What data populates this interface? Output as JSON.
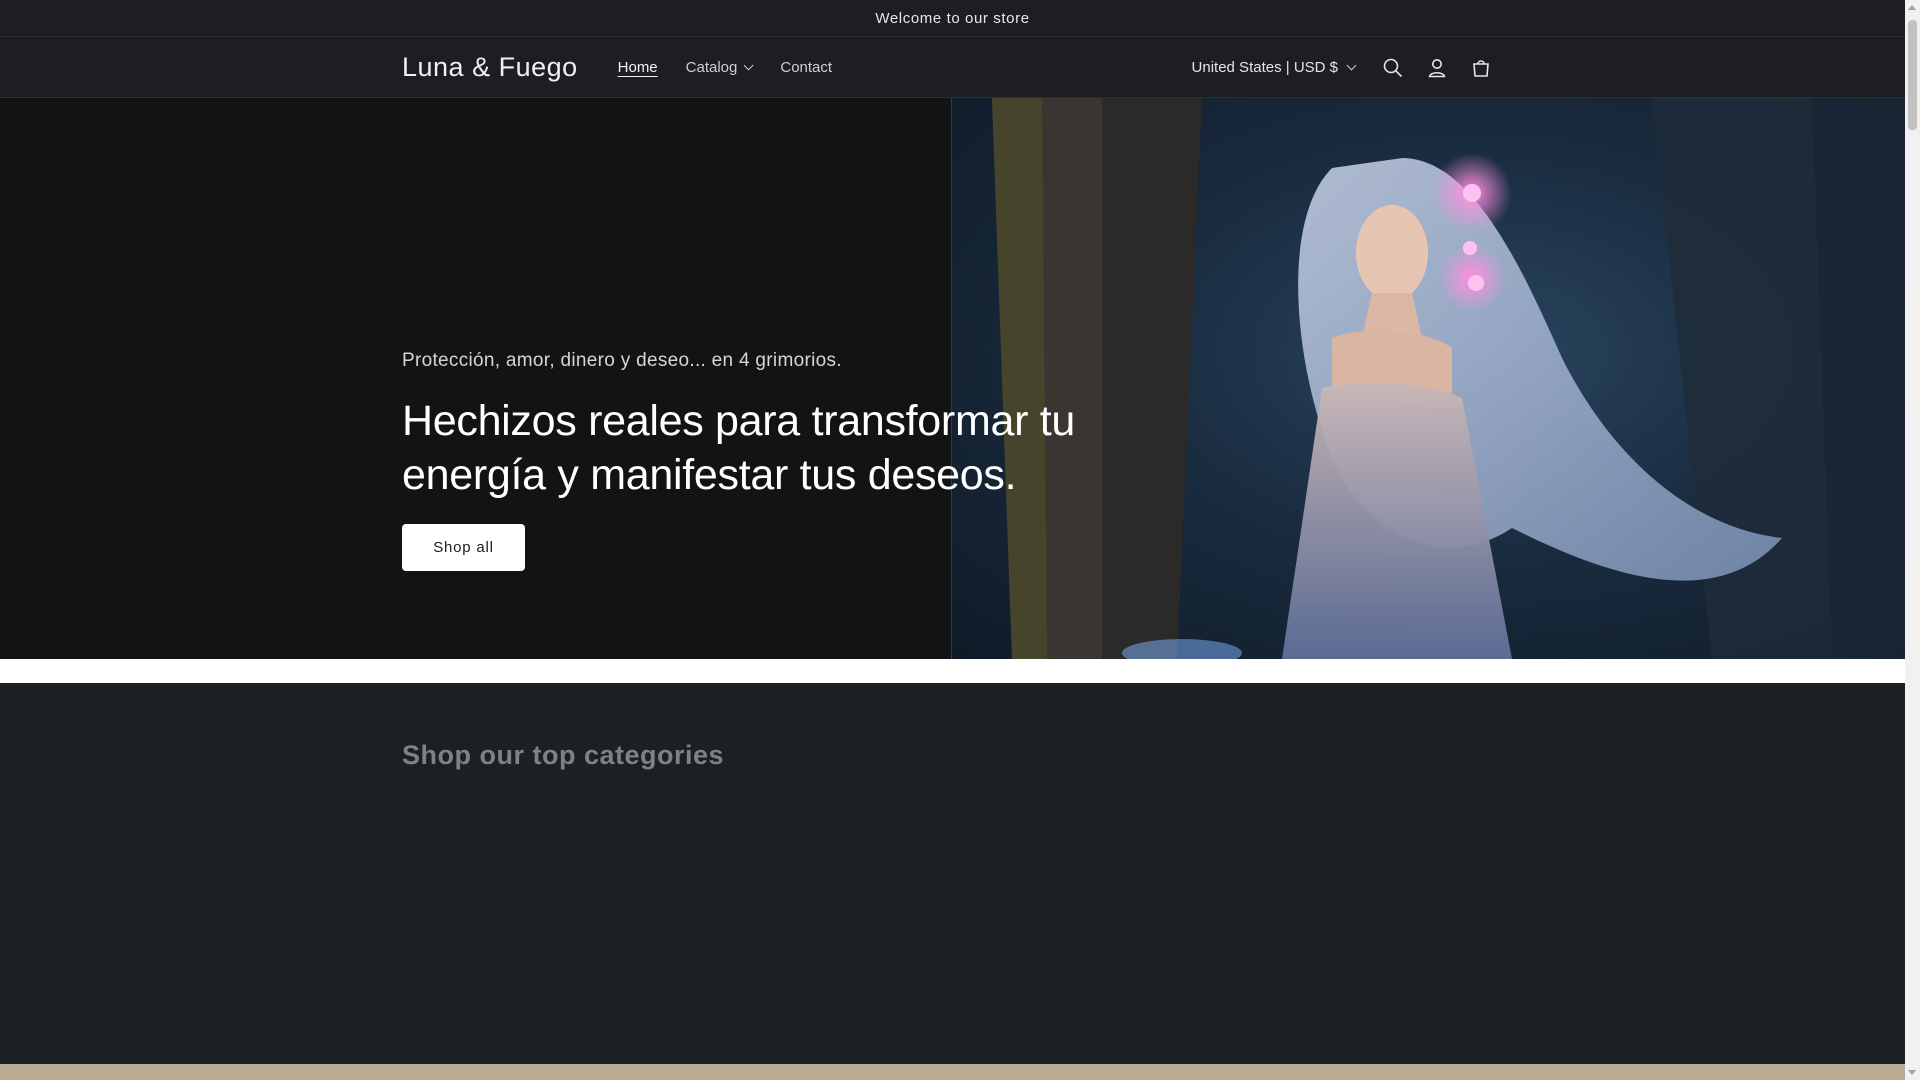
{
  "announcement": {
    "text": "Welcome to our store"
  },
  "header": {
    "logo": "Luna & Fuego",
    "nav": [
      {
        "label": "Home",
        "active": true
      },
      {
        "label": "Catalog",
        "has_dropdown": true
      },
      {
        "label": "Contact"
      }
    ],
    "country_selector": "United States | USD $",
    "icons": [
      "search-icon",
      "account-icon",
      "cart-icon"
    ]
  },
  "hero": {
    "subtitle": "Protección, amor, dinero y deseo... en 4 grimorios.",
    "title": "Hechizos reales para transformar tu energía y manifestar tus deseos.",
    "button_label": "Shop all"
  },
  "categories": {
    "heading": "Shop our top categories"
  },
  "colors": {
    "background": "#1c1f24",
    "hero_left": "#121315",
    "button_bg": "#ffffff",
    "footer_band": "#b9ab91"
  }
}
